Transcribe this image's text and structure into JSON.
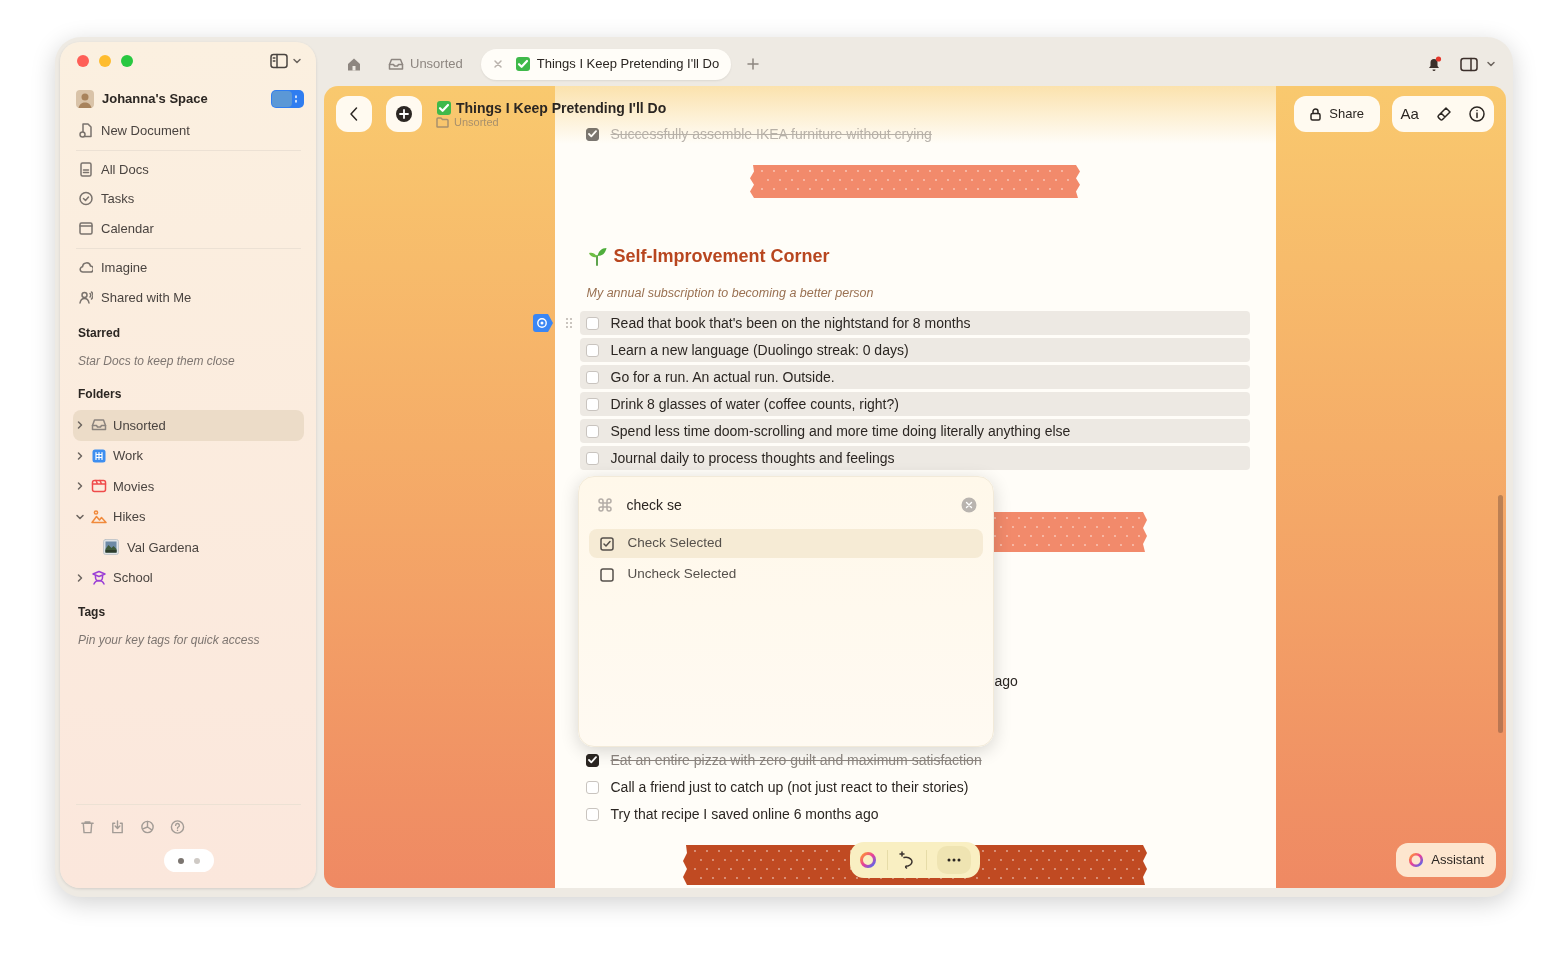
{
  "sidebar": {
    "space": {
      "name": "Johanna's Space"
    },
    "new_document": "New Document",
    "nav": [
      {
        "label": "All Docs"
      },
      {
        "label": "Tasks"
      },
      {
        "label": "Calendar"
      }
    ],
    "nav2": [
      {
        "label": "Imagine"
      },
      {
        "label": "Shared with Me"
      }
    ],
    "starred": {
      "heading": "Starred",
      "hint": "Star Docs to keep them close"
    },
    "folders": {
      "heading": "Folders",
      "items": [
        {
          "label": "Unsorted",
          "selected": true,
          "expanded": false
        },
        {
          "label": "Work",
          "selected": false,
          "expanded": false
        },
        {
          "label": "Movies",
          "selected": false,
          "expanded": false
        },
        {
          "label": "Hikes",
          "selected": false,
          "expanded": true,
          "children": [
            {
              "label": "Val Gardena",
              "selected": false
            }
          ]
        },
        {
          "label": "School",
          "selected": false,
          "expanded": false
        }
      ]
    },
    "tags": {
      "heading": "Tags",
      "hint": "Pin your key tags for quick access"
    },
    "pager": [
      {
        "selected": true
      },
      {
        "selected": false
      }
    ]
  },
  "tabs": [
    {
      "label": "Unsorted",
      "selected": false
    },
    {
      "label": "Things I Keep Pretending I'll Do",
      "selected": true
    }
  ],
  "notifications": {
    "unread": true
  },
  "document": {
    "title": "Things I Keep Pretending I'll Do",
    "folder": "Unsorted",
    "share": "Share",
    "format": "Aa",
    "blocks": [
      {
        "kind": "task",
        "text": "Successfully assemble IKEA furniture without crying",
        "checked": true,
        "selected": false,
        "faded": true
      },
      {
        "kind": "tape",
        "color": "#f28a6b"
      },
      {
        "kind": "heading",
        "text": "Self-Improvement Corner"
      },
      {
        "kind": "subtitle",
        "text": "My annual subscription to becoming a better person"
      },
      {
        "kind": "task",
        "text": "Read that book that's been on the nightstand for 8 months",
        "checked": false,
        "selected": true,
        "hovered": true
      },
      {
        "kind": "task",
        "text": "Learn a new language (Duolingo streak: 0 days)",
        "checked": false,
        "selected": true
      },
      {
        "kind": "task",
        "text": "Go for a run. An actual run. Outside.",
        "checked": false,
        "selected": true
      },
      {
        "kind": "task",
        "text": "Drink 8 glasses of water (coffee counts, right?)",
        "checked": false,
        "selected": true
      },
      {
        "kind": "task",
        "text": "Spend less time doom-scrolling and more time doing literally anything else",
        "checked": false,
        "selected": true
      },
      {
        "kind": "task",
        "text": "Journal daily to process thoughts and feelings",
        "checked": false,
        "selected": true
      },
      {
        "kind": "tape",
        "color": "#f28a6b"
      },
      {
        "kind": "fragment",
        "text": "ago"
      },
      {
        "kind": "task",
        "text": "Eat an entire pizza with zero guilt and maximum satisfaction",
        "checked": true,
        "selected": false
      },
      {
        "kind": "task",
        "text": "Call a friend just to catch up (not just react to their stories)",
        "checked": false,
        "selected": false
      },
      {
        "kind": "task",
        "text": "Try that recipe I saved online 6 months ago",
        "checked": false,
        "selected": false
      },
      {
        "kind": "tape",
        "color": "#c04a22"
      }
    ]
  },
  "command_palette": {
    "query": "check se",
    "results": [
      {
        "label": "Check Selected",
        "selected": true
      },
      {
        "label": "Uncheck Selected",
        "selected": false
      }
    ]
  },
  "assistant": "Assistant"
}
